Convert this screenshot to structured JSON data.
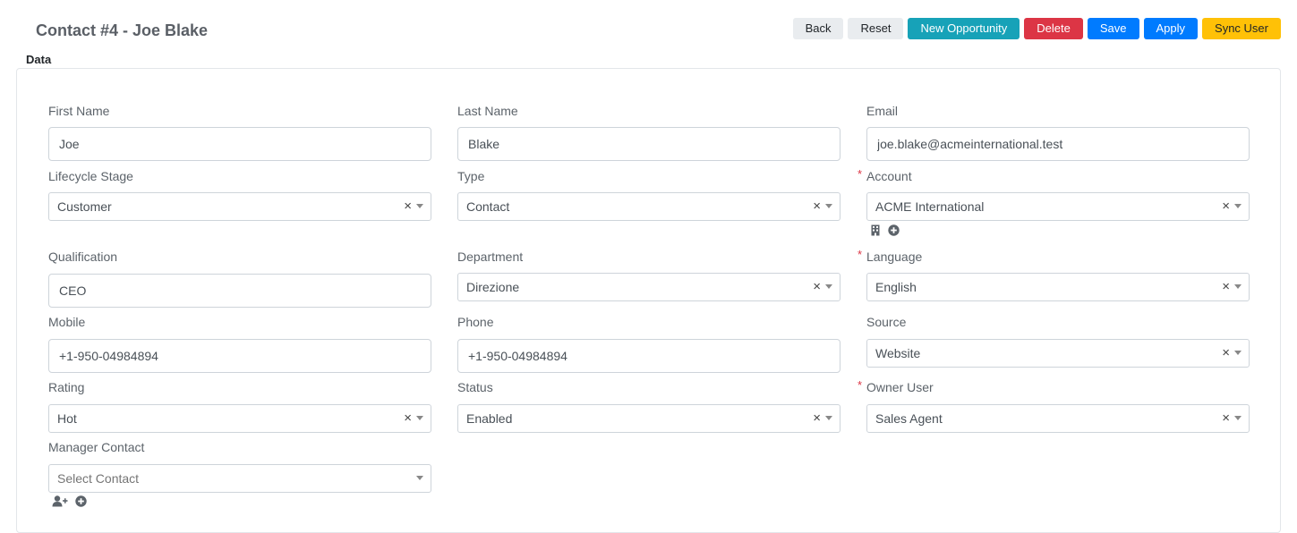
{
  "page": {
    "title": "Contact #4 - Joe Blake",
    "section": "Data"
  },
  "toolbar": {
    "back": "Back",
    "reset": "Reset",
    "new_opportunity": "New Opportunity",
    "delete": "Delete",
    "save": "Save",
    "apply": "Apply",
    "sync_user": "Sync User"
  },
  "fields": {
    "first_name": {
      "label": "First Name",
      "value": "Joe"
    },
    "last_name": {
      "label": "Last Name",
      "value": "Blake"
    },
    "email": {
      "label": "Email",
      "value": "joe.blake@acmeinternational.test"
    },
    "lifecycle_stage": {
      "label": "Lifecycle Stage",
      "value": "Customer"
    },
    "type": {
      "label": "Type",
      "value": "Contact"
    },
    "account": {
      "label": "Account",
      "value": "ACME International",
      "required": "*"
    },
    "qualification": {
      "label": "Qualification",
      "value": "CEO"
    },
    "department": {
      "label": "Department",
      "value": "Direzione"
    },
    "language": {
      "label": "Language",
      "value": "English",
      "required": "*"
    },
    "mobile": {
      "label": "Mobile",
      "value": "+1-950-04984894"
    },
    "phone": {
      "label": "Phone",
      "value": "+1-950-04984894"
    },
    "source": {
      "label": "Source",
      "value": "Website"
    },
    "rating": {
      "label": "Rating",
      "value": "Hot"
    },
    "status": {
      "label": "Status",
      "value": "Enabled"
    },
    "owner_user": {
      "label": "Owner User",
      "value": "Sales Agent",
      "required": "*"
    },
    "manager_contact": {
      "label": "Manager Contact",
      "placeholder": "Select Contact"
    }
  },
  "select_clear_symbol": "×",
  "icons": {
    "account_link": "building-icon",
    "account_add": "plus-circle-icon",
    "manager_link": "user-plus-icon",
    "manager_add": "plus-circle-icon"
  },
  "colors": {
    "info": "#17a2b8",
    "danger": "#dc3545",
    "primary": "#007bff",
    "warning": "#ffc107",
    "light": "#e9ecef"
  }
}
